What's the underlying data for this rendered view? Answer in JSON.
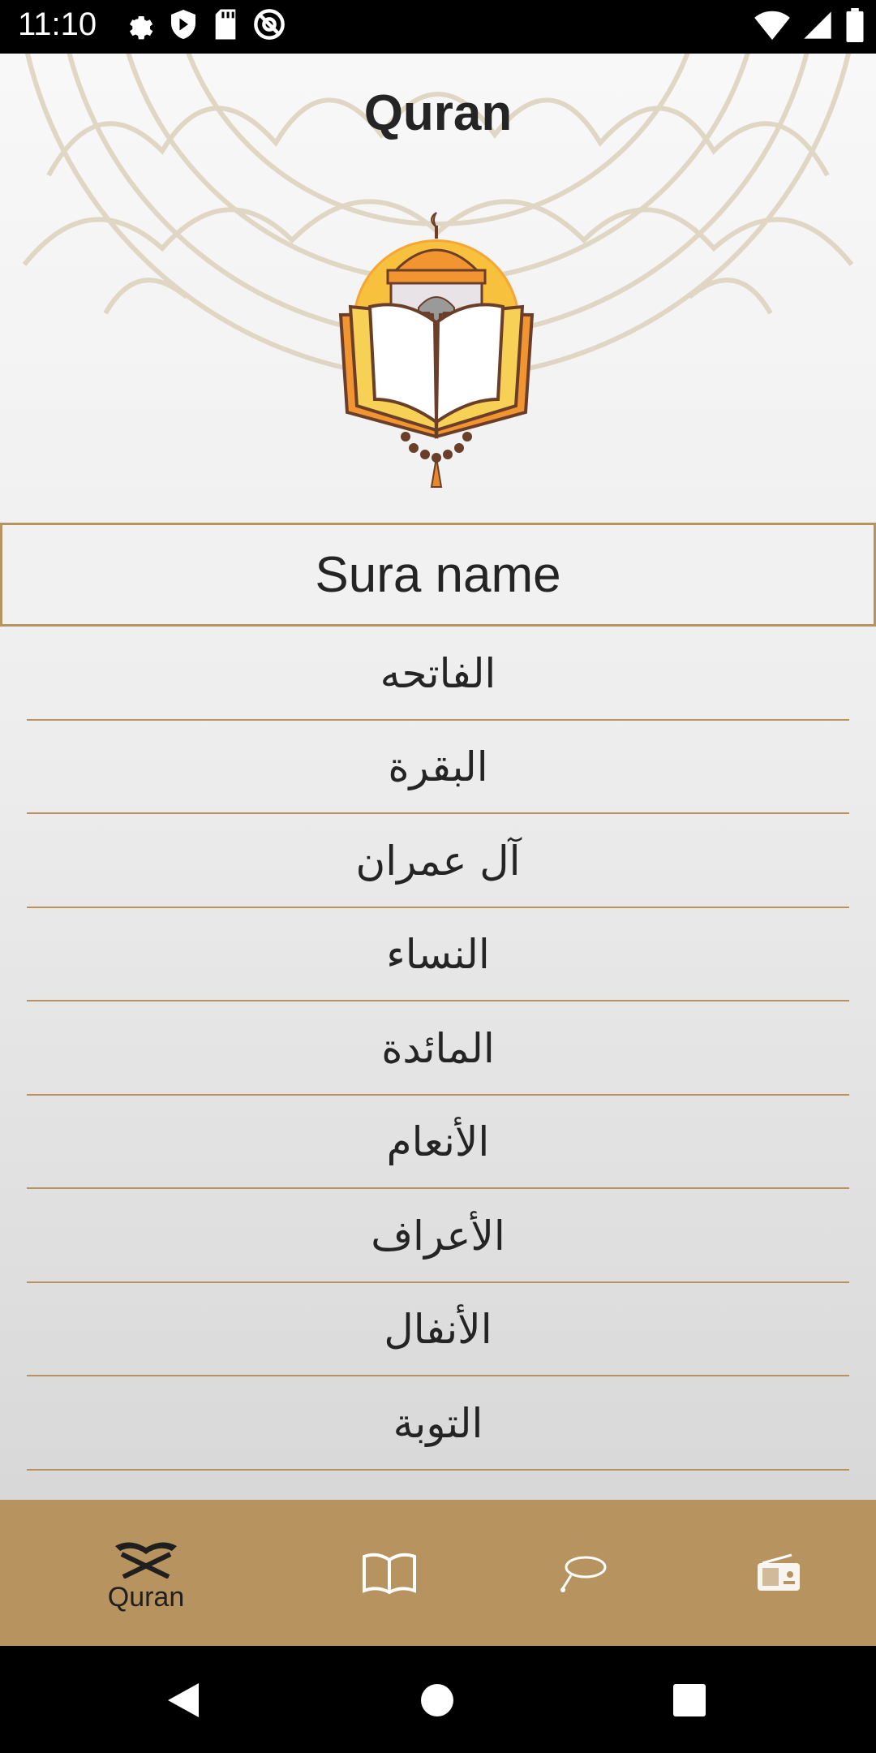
{
  "status_bar": {
    "time": "11:10",
    "left_icons": [
      "settings-icon",
      "shield-play-icon",
      "sd-card-icon",
      "at-sign-icon"
    ],
    "right_icons": [
      "wifi-icon",
      "signal-icon",
      "battery-icon"
    ]
  },
  "app": {
    "title": "Quran",
    "list_header": "Sura name"
  },
  "suras": [
    "الفاتحه",
    "البقرة",
    "آل عمران",
    "النساء",
    "المائدة",
    "الأنعام",
    "الأعراف",
    "الأنفال",
    "التوبة"
  ],
  "bottom_nav": {
    "items": [
      {
        "label": "Quran",
        "icon": "quran-stand-icon",
        "selected": true
      },
      {
        "label": "",
        "icon": "open-book-icon",
        "selected": false
      },
      {
        "label": "",
        "icon": "tasbeeh-icon",
        "selected": false
      },
      {
        "label": "",
        "icon": "radio-icon",
        "selected": false
      }
    ]
  },
  "system_nav": {
    "icons": [
      "back-icon",
      "home-icon",
      "recents-icon"
    ]
  },
  "colors": {
    "accent": "#B7935F",
    "text": "#242424"
  }
}
